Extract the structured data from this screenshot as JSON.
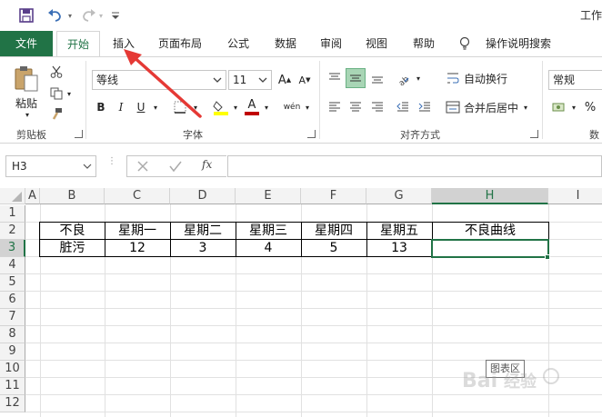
{
  "window": {
    "title_partial": "工作"
  },
  "tabs": [
    "文件",
    "开始",
    "插入",
    "页面布局",
    "公式",
    "数据",
    "审阅",
    "视图",
    "帮助"
  ],
  "tell_me": "操作说明搜索",
  "ribbon": {
    "clipboard": {
      "paste": "粘贴",
      "group": "剪贴板"
    },
    "font": {
      "name": "等线",
      "size": "11",
      "group": "字体",
      "bold": "B",
      "italic": "I",
      "underline": "U",
      "font_color_glyph": "A",
      "phonetic": "wén"
    },
    "alignment": {
      "wrap_text": "自动换行",
      "merge_center": "合并后居中",
      "group": "对齐方式"
    },
    "number": {
      "format": "常规",
      "percent": "%",
      "group_partial": "数"
    }
  },
  "formula_bar": {
    "name_box": "H3",
    "fx": "fx",
    "value": ""
  },
  "columns": [
    "A",
    "B",
    "C",
    "D",
    "E",
    "F",
    "G",
    "H",
    "I"
  ],
  "rows": [
    "1",
    "2",
    "3",
    "4",
    "5",
    "6",
    "7",
    "8",
    "9",
    "10",
    "11",
    "12"
  ],
  "table": {
    "headers": [
      "不良",
      "星期一",
      "星期二",
      "星期三",
      "星期四",
      "星期五",
      "不良曲线"
    ],
    "row": [
      "脏污",
      "12",
      "3",
      "4",
      "5",
      "13",
      ""
    ]
  },
  "selected_cell": "H3",
  "tooltip": "图表区",
  "watermark": "Bai经验",
  "colors": {
    "accent": "#217346",
    "arrow": "#e53935",
    "font_color_bar": "#c00000",
    "highlight_bar": "#ffff00"
  }
}
